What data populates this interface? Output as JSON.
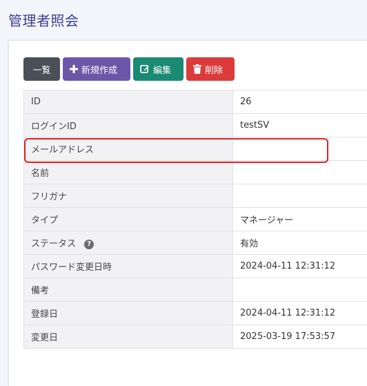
{
  "page": {
    "title": "管理者照会"
  },
  "toolbar": {
    "list_label": "一覧",
    "new_label": "新規作成",
    "edit_label": "編集",
    "delete_label": "削除",
    "colors": {
      "list": "#495057",
      "new": "#6b57a8",
      "edit": "#1a8a73",
      "delete": "#dc3b3b"
    }
  },
  "details": {
    "rows": [
      {
        "label": "ID",
        "value": "26"
      },
      {
        "label": "ログインID",
        "value": "testSV"
      },
      {
        "label": "メールアドレス",
        "value": ""
      },
      {
        "label": "名前",
        "value": ""
      },
      {
        "label": "フリガナ",
        "value": ""
      },
      {
        "label": "タイプ",
        "value": "マネージャー"
      },
      {
        "label": "ステータス",
        "value": "有効",
        "help_icon": "?"
      },
      {
        "label": "パスワード変更日時",
        "value": "2024-04-11 12:31:12"
      },
      {
        "label": "備考",
        "value": ""
      },
      {
        "label": "登録日",
        "value": "2024-04-11 12:31:12"
      },
      {
        "label": "変更日",
        "value": "2025-03-19 17:53:57"
      }
    ]
  },
  "highlight": {
    "color": "#e02020",
    "target": "メールアドレス"
  }
}
